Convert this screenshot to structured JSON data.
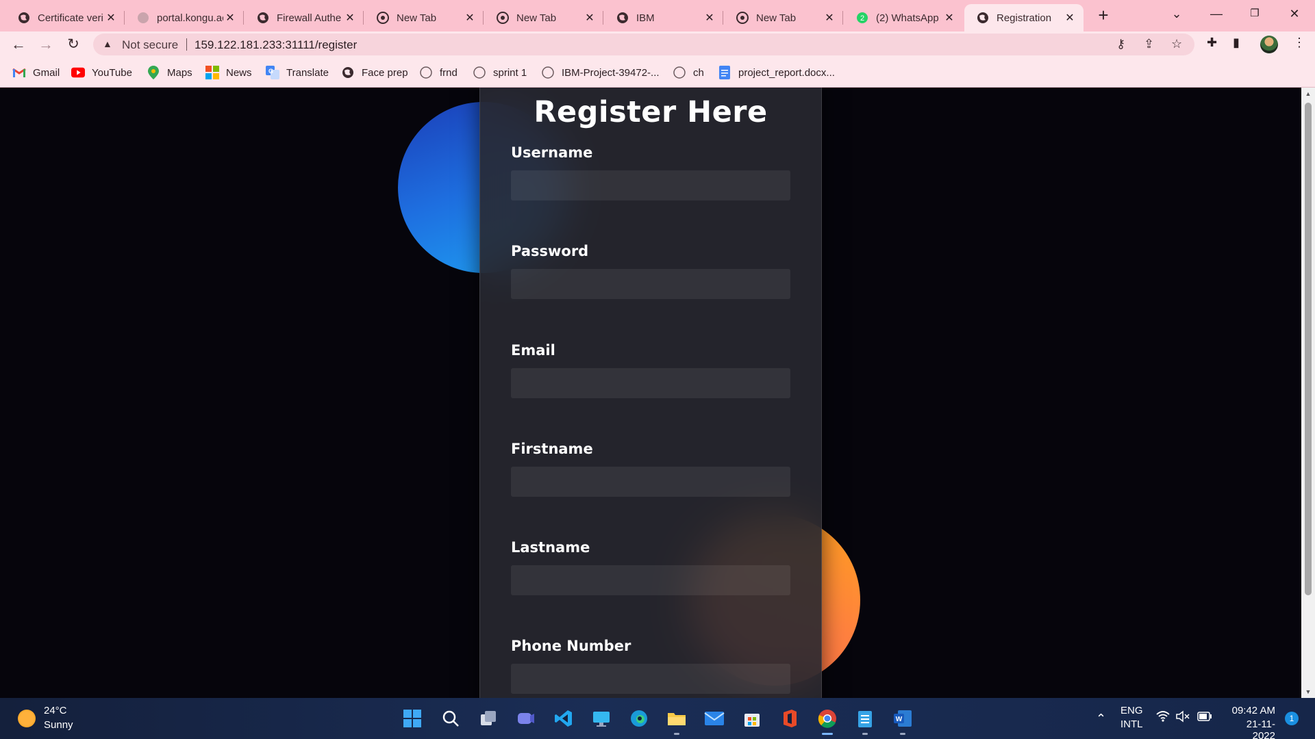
{
  "browser": {
    "tabs": [
      {
        "title": "Certificate veri",
        "favicon": "globe-icon"
      },
      {
        "title": "portal.kongu.ac",
        "favicon": "globe-faded-icon"
      },
      {
        "title": "Firewall Authe",
        "favicon": "globe-icon"
      },
      {
        "title": "New Tab",
        "favicon": "chrome-icon"
      },
      {
        "title": "New Tab",
        "favicon": "chrome-icon"
      },
      {
        "title": "IBM",
        "favicon": "globe-icon"
      },
      {
        "title": "New Tab",
        "favicon": "chrome-icon"
      },
      {
        "title": "(2) WhatsApp",
        "favicon": "whatsapp-icon",
        "badge": "2"
      },
      {
        "title": "Registration",
        "favicon": "globe-icon",
        "active": true
      }
    ],
    "new_tab_symbol": "+",
    "tab_close_symbol": "✕",
    "address": {
      "security_label": "Not secure",
      "url": "159.122.181.233:31111/register"
    },
    "bookmarks": [
      {
        "label": "Gmail",
        "icon": "gmail-icon"
      },
      {
        "label": "YouTube",
        "icon": "youtube-icon"
      },
      {
        "label": "Maps",
        "icon": "maps-icon"
      },
      {
        "label": "News",
        "icon": "news-icon"
      },
      {
        "label": "Translate",
        "icon": "translate-icon"
      },
      {
        "label": "Face prep",
        "icon": "globe-icon"
      },
      {
        "label": "frnd",
        "icon": "github-icon"
      },
      {
        "label": "sprint 1",
        "icon": "github-icon"
      },
      {
        "label": "IBM-Project-39472-...",
        "icon": "github-icon"
      },
      {
        "label": "ch",
        "icon": "github-icon"
      },
      {
        "label": "project_report.docx...",
        "icon": "docs-icon"
      }
    ],
    "theme_color": "#fbc2cf"
  },
  "page": {
    "title": "Register Here",
    "fields": [
      {
        "label": "Username",
        "value": ""
      },
      {
        "label": "Password",
        "value": ""
      },
      {
        "label": "Email",
        "value": ""
      },
      {
        "label": "Firstname",
        "value": ""
      },
      {
        "label": "Lastname",
        "value": ""
      },
      {
        "label": "Phone Number",
        "value": ""
      }
    ],
    "blob_colors": {
      "blue": "#1e6fe0",
      "orange": "#ff8a30"
    }
  },
  "taskbar": {
    "weather": {
      "temp": "24°C",
      "condition": "Sunny"
    },
    "apps": [
      "windows-start-icon",
      "search-icon",
      "task-view-icon",
      "teams-icon",
      "vscode-icon",
      "desktop-icon",
      "edge-icon",
      "file-explorer-icon",
      "mail-icon",
      "store-icon",
      "office-icon",
      "chrome-icon",
      "notepad-icon",
      "word-icon"
    ],
    "tray": {
      "language": "ENG",
      "layout": "INTL",
      "time": "09:42 AM",
      "date": "21-11-2022",
      "notifications": "1"
    }
  }
}
